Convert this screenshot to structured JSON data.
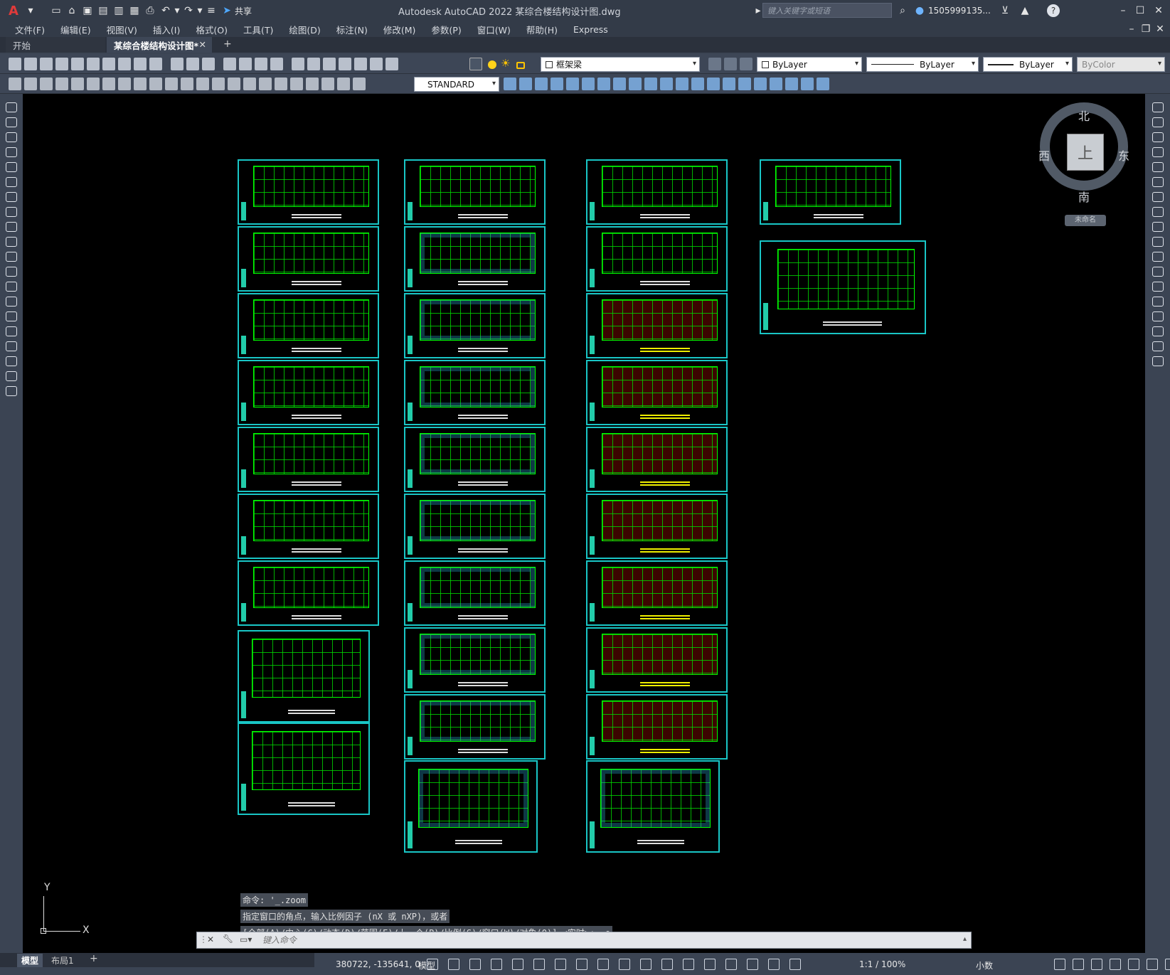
{
  "app": {
    "title": "Autodesk AutoCAD 2022    某综合楼结构设计图.dwg",
    "logo": "A",
    "share_label": "共享",
    "search_placeholder": "键入关键字或短语",
    "user": "1505999135...",
    "accent": "#19c6c6"
  },
  "menu": [
    "文件(F)",
    "编辑(E)",
    "视图(V)",
    "插入(I)",
    "格式(O)",
    "工具(T)",
    "绘图(D)",
    "标注(N)",
    "修改(M)",
    "参数(P)",
    "窗口(W)",
    "帮助(H)",
    "Express"
  ],
  "tabs": {
    "start": "开始",
    "file": "某综合楼结构设计图*"
  },
  "properties": {
    "layer": "框架梁",
    "color": "ByLayer",
    "linetype": "ByLayer",
    "lineweight": "ByLayer",
    "plotstyle": "ByColor",
    "textstyle": "STANDARD"
  },
  "viewcube": {
    "north": "北",
    "south": "南",
    "east": "东",
    "west": "西",
    "top": "上",
    "ucs": "未命名"
  },
  "ucs_axes": {
    "x": "X",
    "y": "Y"
  },
  "command": {
    "history": [
      "命令: '_.zoom",
      "指定窗口的角点，输入比例因子 (nX 或 nXP)，或者",
      "[全部(A)/中心(C)/动态(D)/范围(E)/上一个(P)/比例(S)/窗口(W)/对象(O)] <实时>: _e"
    ],
    "placeholder": "键入命令"
  },
  "layout_tabs": {
    "model": "模型",
    "layout1": "布局1"
  },
  "status": {
    "coords": "380722, -135641, 0",
    "model": "模型",
    "scale": "1:1 / 100%",
    "units": "小数"
  }
}
